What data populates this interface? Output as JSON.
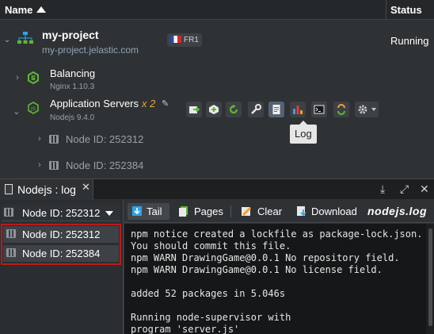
{
  "header": {
    "name_label": "Name",
    "status_label": "Status"
  },
  "environment": {
    "name": "my-project",
    "url": "my-project.jelastic.com",
    "region": "FR1",
    "status": "Running"
  },
  "balancing": {
    "title": "Balancing",
    "subtitle": "Nginx 1.10.3"
  },
  "app_servers": {
    "title": "Application Servers",
    "scale": "x 2",
    "subtitle": "Nodejs 9.4.0",
    "nodes": [
      "Node ID: 252312",
      "Node ID: 252384"
    ]
  },
  "tooltip": "Log",
  "log_panel": {
    "tab_title": "Nodejs : log",
    "tab_close": "✕",
    "node_selector": "Node ID: 252312",
    "node_list": [
      "Node ID: 252312",
      "Node ID: 252384"
    ],
    "toolbar": {
      "tail": "Tail",
      "pages": "Pages",
      "clear": "Clear",
      "download": "Download"
    },
    "log_file": "nodejs.log",
    "lines": [
      "npm notice created a lockfile as package-lock.json.",
      "You should commit this file.",
      "npm WARN DrawingGame@0.0.1 No repository field.",
      "npm WARN DrawingGame@0.0.1 No license field.",
      "",
      "added 52 packages in 5.046s",
      "",
      "Running node-supervisor with",
      "program 'server.js'"
    ]
  },
  "colors": {
    "scale_accent": "#f0a030",
    "highlight_border": "#c01818",
    "nodejs_green": "#5fb832"
  }
}
